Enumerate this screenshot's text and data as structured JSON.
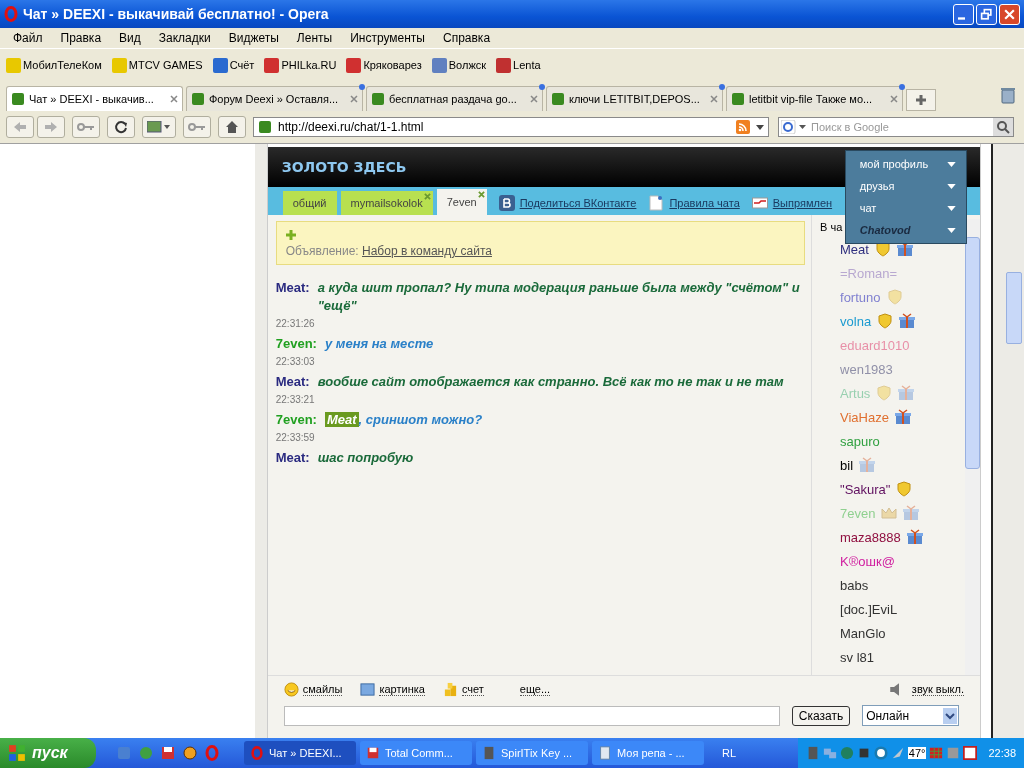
{
  "window": {
    "title": "Чат » DEEXI - выкачивай бесплатно! - Opera"
  },
  "menu": [
    "Файл",
    "Правка",
    "Вид",
    "Закладки",
    "Виджеты",
    "Ленты",
    "Инструменты",
    "Справка"
  ],
  "bookmarks": [
    {
      "label": "МобилТелеКом",
      "color": "#e8c800"
    },
    {
      "label": "MTCV GAMES",
      "color": "#e8c800"
    },
    {
      "label": "Счёт",
      "color": "#2a6ad0"
    },
    {
      "label": "PHILka.RU",
      "color": "#d03030"
    },
    {
      "label": "Кряковарез",
      "color": "#d03030"
    },
    {
      "label": "Волжск",
      "color": "#6080c0"
    },
    {
      "label": "Lenta",
      "color": "#c03030"
    }
  ],
  "tabs": [
    {
      "label": "Чат » DEEXI - выкачив...",
      "selected": true,
      "unread": false
    },
    {
      "label": "Форум Deexi » Оставля...",
      "selected": false,
      "unread": true
    },
    {
      "label": "бесплатная раздача go...",
      "selected": false,
      "unread": true
    },
    {
      "label": "ключи LETITBIT,DEPOS...",
      "selected": false,
      "unread": true
    },
    {
      "label": "letitbit vip-file Также мо...",
      "selected": false,
      "unread": true
    }
  ],
  "address": {
    "url": "http://deexi.ru/chat/1-1.html"
  },
  "search": {
    "placeholder": "Поиск в Google"
  },
  "chat": {
    "title": "ЗОЛОТО ЗДЕСЬ",
    "tabs": [
      {
        "label": "общий",
        "selected": false,
        "closable": false
      },
      {
        "label": "mymailsokolok",
        "selected": false,
        "closable": true
      },
      {
        "label": "7even",
        "selected": true,
        "closable": true
      }
    ],
    "links": [
      {
        "kind": "vk",
        "label": "Поделиться ВКонтакте"
      },
      {
        "kind": "rules",
        "label": "Правила чата"
      },
      {
        "kind": "mail",
        "label": "Выпрямлен"
      }
    ],
    "announcement": {
      "label": "Объявление:",
      "link": "Набор в команду сайта"
    },
    "log": [
      {
        "kind": "message",
        "author": "Meat:",
        "color": "#2a2a80",
        "own": false,
        "text": "а куда шит пропал? Ну типа модерация раньше была между \"счётом\" и \"ещё\""
      },
      {
        "kind": "time",
        "text": "22:31:26"
      },
      {
        "kind": "message",
        "author": "7even:",
        "color": "#20a020",
        "own": true,
        "text": "у меня на месте"
      },
      {
        "kind": "time",
        "text": "22:33:03"
      },
      {
        "kind": "message",
        "author": "Meat:",
        "color": "#2a2a80",
        "own": false,
        "text": "вообше сайт отображается как странно. Всё как то не так и не там"
      },
      {
        "kind": "time",
        "text": "22:33:21"
      },
      {
        "kind": "message",
        "author": "7even:",
        "color": "#20a020",
        "own": true,
        "mention": "Meat",
        "text": ", сриншот можно?"
      },
      {
        "kind": "time",
        "text": "22:33:59"
      },
      {
        "kind": "message",
        "author": "Meat:",
        "color": "#2a2a80",
        "own": false,
        "text": "шас попробую"
      }
    ],
    "user_menu": [
      {
        "kind": "text",
        "label": "мой профиль"
      },
      {
        "kind": "text",
        "label": "друзья"
      },
      {
        "kind": "text",
        "label": "чат"
      },
      {
        "kind": "logo",
        "label": "Chatovod"
      }
    ],
    "users_header": "В ча",
    "users": [
      {
        "name": "Meat",
        "color": "#2e2e7e",
        "badges": [
          {
            "kind": "shield",
            "faded": false
          },
          {
            "kind": "gift",
            "faded": false
          }
        ]
      },
      {
        "name": "=Roman=",
        "color": "#b8a8d0"
      },
      {
        "name": "fortuno",
        "color": "#8080d0",
        "badges": [
          {
            "kind": "shield",
            "faded": true
          }
        ]
      },
      {
        "name": "volna",
        "color": "#1a9ad0",
        "badges": [
          {
            "kind": "shield",
            "faded": false
          },
          {
            "kind": "gift",
            "faded": false
          }
        ]
      },
      {
        "name": "eduard1010",
        "color": "#e890a8"
      },
      {
        "name": "wen1983",
        "color": "#9090a8"
      },
      {
        "name": "Artus",
        "color": "#98d0b0",
        "badges": [
          {
            "kind": "shield",
            "faded": true
          },
          {
            "kind": "gift",
            "faded": true
          }
        ]
      },
      {
        "name": "ViaHaze",
        "color": "#e07030",
        "badges": [
          {
            "kind": "gift",
            "faded": false
          }
        ]
      },
      {
        "name": "sapuro",
        "color": "#30a040"
      },
      {
        "name": "bil",
        "color": "#000000",
        "badges": [
          {
            "kind": "gift",
            "faded": true
          }
        ]
      },
      {
        "name": "\"Sakura\"",
        "color": "#601060",
        "badges": [
          {
            "kind": "shield",
            "faded": false
          }
        ]
      },
      {
        "name": "7even",
        "color": "#90d090",
        "badges": [
          {
            "kind": "crown",
            "faded": true
          },
          {
            "kind": "gift",
            "faded": true
          }
        ]
      },
      {
        "name": "maza8888",
        "color": "#901040",
        "badges": [
          {
            "kind": "gift",
            "faded": false
          }
        ]
      },
      {
        "name": "K®ошк@",
        "color": "#d020a0"
      },
      {
        "name": "babs",
        "color": "#333333"
      },
      {
        "name": "[doc.]EviL",
        "color": "#333333"
      },
      {
        "name": "ManGlo",
        "color": "#333333"
      },
      {
        "name": "sv l81",
        "color": "#333333"
      }
    ],
    "tools": [
      {
        "kind": "smile",
        "label": "смайлы"
      },
      {
        "kind": "picture",
        "label": "картинка"
      },
      {
        "kind": "coins",
        "label": "счет"
      },
      {
        "kind": "more",
        "label": "еще..."
      }
    ],
    "sound": "звук выкл.",
    "send": "Сказать",
    "status": "Онлайн"
  },
  "taskbar": {
    "start": "пуск",
    "tasks": [
      {
        "label": "Чат » DEEXI...",
        "selected": true,
        "kind": "ring"
      },
      {
        "label": "Total Comm...",
        "selected": false,
        "kind": "disk"
      },
      {
        "label": "SpirITix Key ...",
        "selected": false,
        "kind": "box"
      },
      {
        "label": "Моя репа - ...",
        "selected": false,
        "kind": "note"
      }
    ],
    "lang": "RL",
    "temp": "47°",
    "clock": "22:38"
  }
}
